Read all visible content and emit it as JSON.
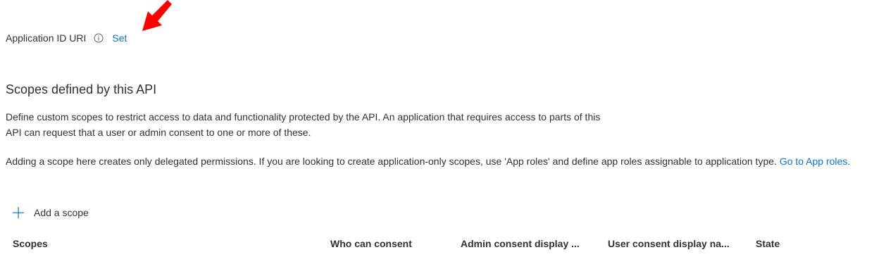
{
  "app_id_uri": {
    "label": "Application ID URI",
    "info_icon": "info-circle-icon",
    "set_link": "Set"
  },
  "annotation": {
    "arrow_icon": "red-arrow-icon",
    "color": "#ff0000"
  },
  "scopes_section": {
    "title": "Scopes defined by this API",
    "description_line1": "Define custom scopes to restrict access to data and functionality protected by the API. An application that requires access to parts of this",
    "description_line2": "API can request that a user or admin consent to one or more of these.",
    "note_text": "Adding a scope here creates only delegated permissions. If you are looking to create application-only scopes, use 'App roles' and define app roles assignable to application type.",
    "note_link": "Go to App roles.",
    "add_scope": {
      "icon": "plus-icon",
      "label": "Add a scope"
    }
  },
  "table": {
    "columns": [
      "Scopes",
      "Who can consent",
      "Admin consent display ...",
      "User consent display na...",
      "State"
    ]
  },
  "colors": {
    "link": "#0078d4",
    "text": "#323130",
    "background": "#ffffff"
  }
}
